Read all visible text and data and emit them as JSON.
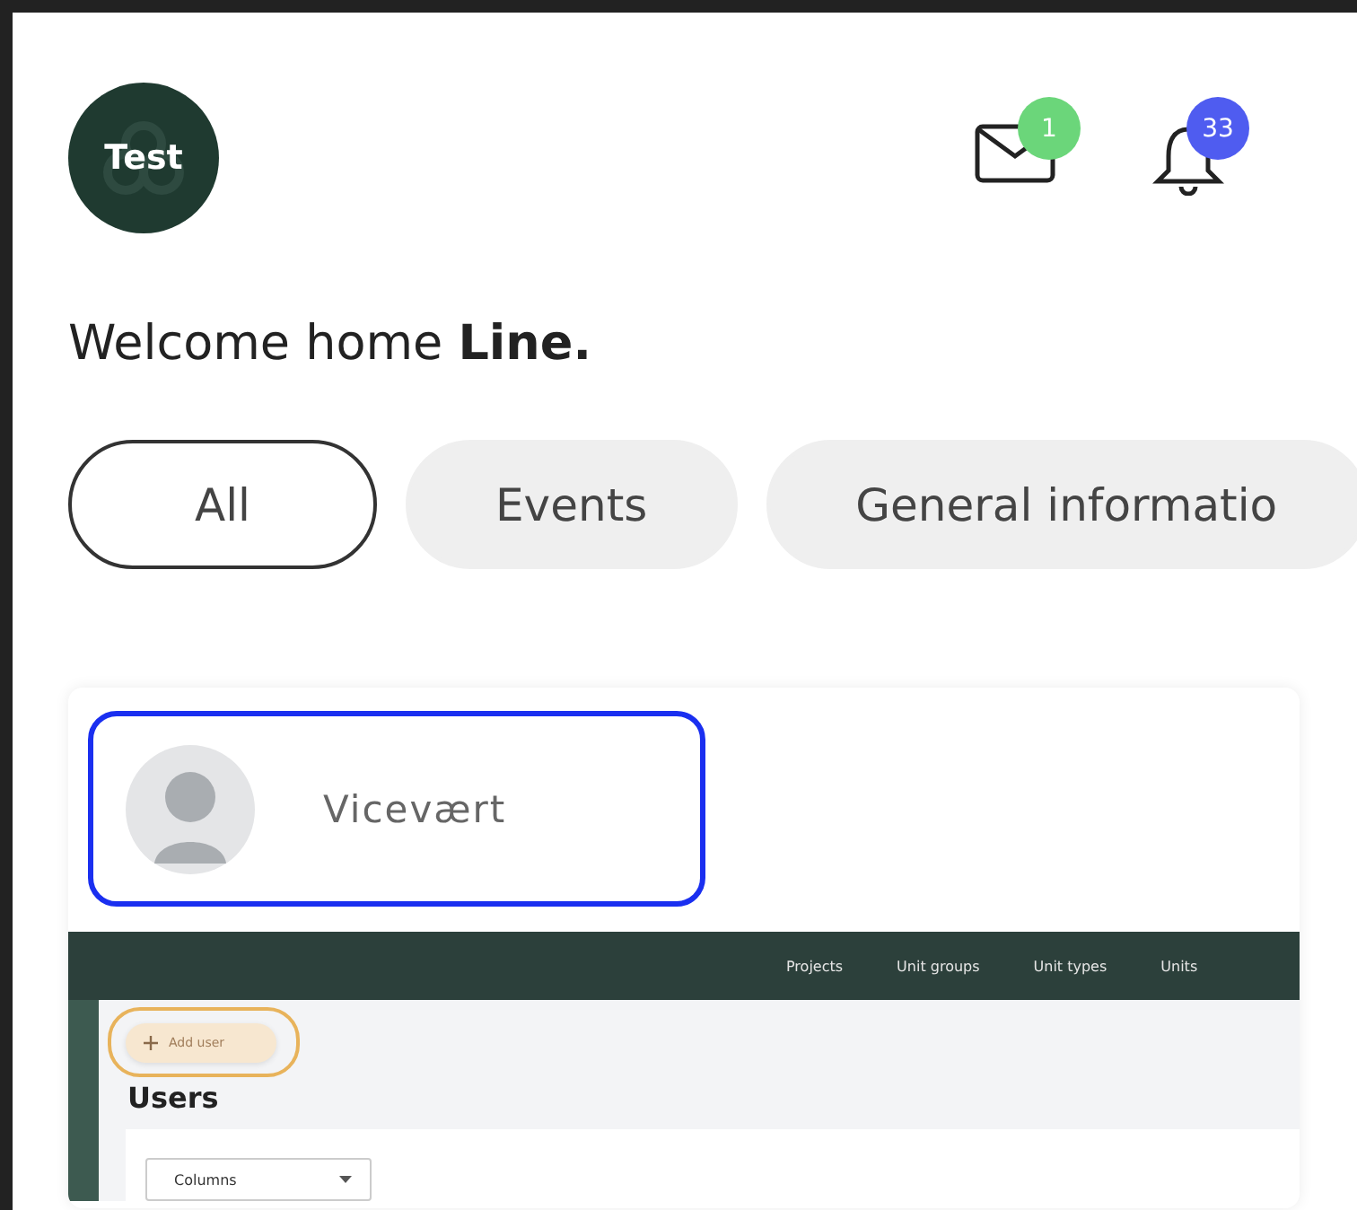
{
  "header": {
    "avatar_text": "Test",
    "messages_badge": "1",
    "notifications_badge": "33"
  },
  "welcome": "Welcome home **Line.**",
  "tabs": [
    {
      "label": "All",
      "selected": true
    },
    {
      "label": "Events",
      "selected": false
    },
    {
      "label": "General informatio",
      "selected": false
    }
  ],
  "post": {
    "author": "Vicevært",
    "screenshot": {
      "nav": [
        "Projects",
        "Unit groups",
        "Unit types",
        "Units"
      ],
      "add_button": "Add user",
      "heading": "Users",
      "dropdown": "Columns"
    }
  }
}
